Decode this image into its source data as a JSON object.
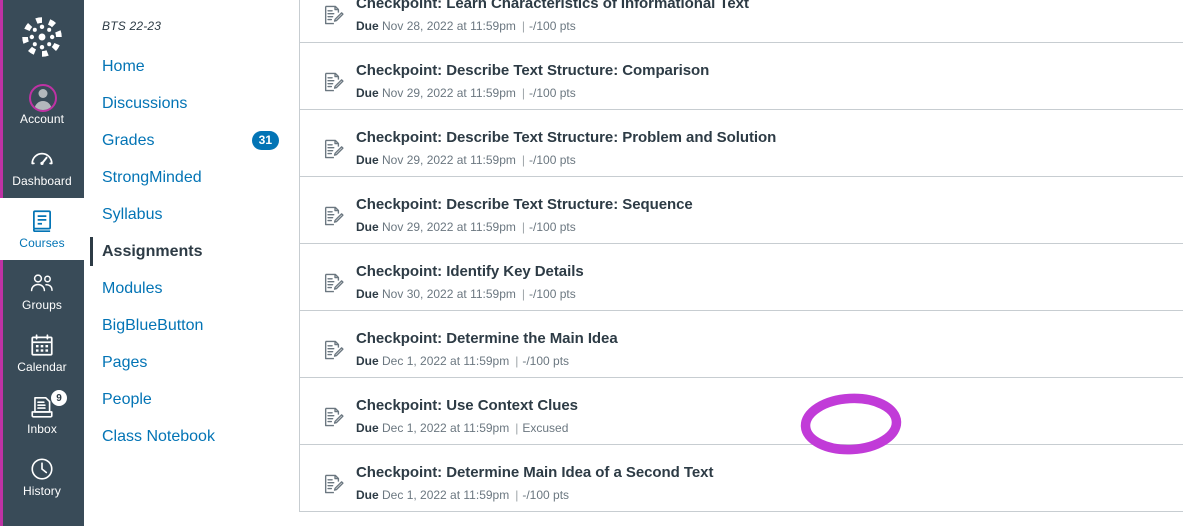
{
  "global_nav": {
    "logo_icon": "canvas-logo-icon",
    "items": [
      {
        "label": "Account",
        "icon": "avatar-icon",
        "active": false,
        "badge": null
      },
      {
        "label": "Dashboard",
        "icon": "dashboard-icon",
        "active": false,
        "badge": null
      },
      {
        "label": "Courses",
        "icon": "book-icon",
        "active": true,
        "badge": null
      },
      {
        "label": "Groups",
        "icon": "groups-icon",
        "active": false,
        "badge": null
      },
      {
        "label": "Calendar",
        "icon": "calendar-icon",
        "active": false,
        "badge": null
      },
      {
        "label": "Inbox",
        "icon": "inbox-icon",
        "active": false,
        "badge": "9"
      },
      {
        "label": "History",
        "icon": "clock-icon",
        "active": false,
        "badge": null
      }
    ]
  },
  "course_nav": {
    "breadcrumb": "BTS 22-23",
    "items": [
      {
        "label": "Home",
        "active": false,
        "badge": null
      },
      {
        "label": "Discussions",
        "active": false,
        "badge": null
      },
      {
        "label": "Grades",
        "active": false,
        "badge": "31"
      },
      {
        "label": "StrongMinded",
        "active": false,
        "badge": null
      },
      {
        "label": "Syllabus",
        "active": false,
        "badge": null
      },
      {
        "label": "Assignments",
        "active": true,
        "badge": null
      },
      {
        "label": "Modules",
        "active": false,
        "badge": null
      },
      {
        "label": "BigBlueButton",
        "active": false,
        "badge": null
      },
      {
        "label": "Pages",
        "active": false,
        "badge": null
      },
      {
        "label": "People",
        "active": false,
        "badge": null
      },
      {
        "label": "Class Notebook",
        "active": false,
        "badge": null
      }
    ]
  },
  "assignments": {
    "due_label": "Due",
    "separator": "|",
    "rows": [
      {
        "title": "Checkpoint: Learn Characteristics of Informational Text",
        "due": "Nov 28, 2022 at 11:59pm",
        "points": "-/100 pts",
        "icon": "assignment-icon"
      },
      {
        "title": "Checkpoint: Describe Text Structure: Comparison",
        "due": "Nov 29, 2022 at 11:59pm",
        "points": "-/100 pts",
        "icon": "assignment-icon"
      },
      {
        "title": "Checkpoint: Describe Text Structure: Problem and Solution",
        "due": "Nov 29, 2022 at 11:59pm",
        "points": "-/100 pts",
        "icon": "assignment-icon"
      },
      {
        "title": "Checkpoint: Describe Text Structure: Sequence",
        "due": "Nov 29, 2022 at 11:59pm",
        "points": "-/100 pts",
        "icon": "assignment-icon"
      },
      {
        "title": "Checkpoint: Identify Key Details",
        "due": "Nov 30, 2022 at 11:59pm",
        "points": "-/100 pts",
        "icon": "assignment-icon"
      },
      {
        "title": "Checkpoint: Determine the Main Idea",
        "due": "Dec 1, 2022 at 11:59pm",
        "points": "-/100 pts",
        "icon": "assignment-icon"
      },
      {
        "title": "Checkpoint: Use Context Clues",
        "due": "Dec 1, 2022 at 11:59pm",
        "points": "Excused",
        "icon": "assignment-icon"
      },
      {
        "title": "Checkpoint: Determine Main Idea of a Second Text",
        "due": "Dec 1, 2022 at 11:59pm",
        "points": "-/100 pts",
        "icon": "assignment-icon"
      }
    ]
  },
  "annotation": {
    "shape": "ellipse-highlight",
    "color": "#C13BD8",
    "target_text": "Excused"
  },
  "colors": {
    "nav_background": "#394B58",
    "accent_magenta": "#BF32A4",
    "link_blue": "#0374B5",
    "text_dark": "#2D3B45",
    "text_muted": "#6B7780",
    "border": "#C7CDD1"
  }
}
